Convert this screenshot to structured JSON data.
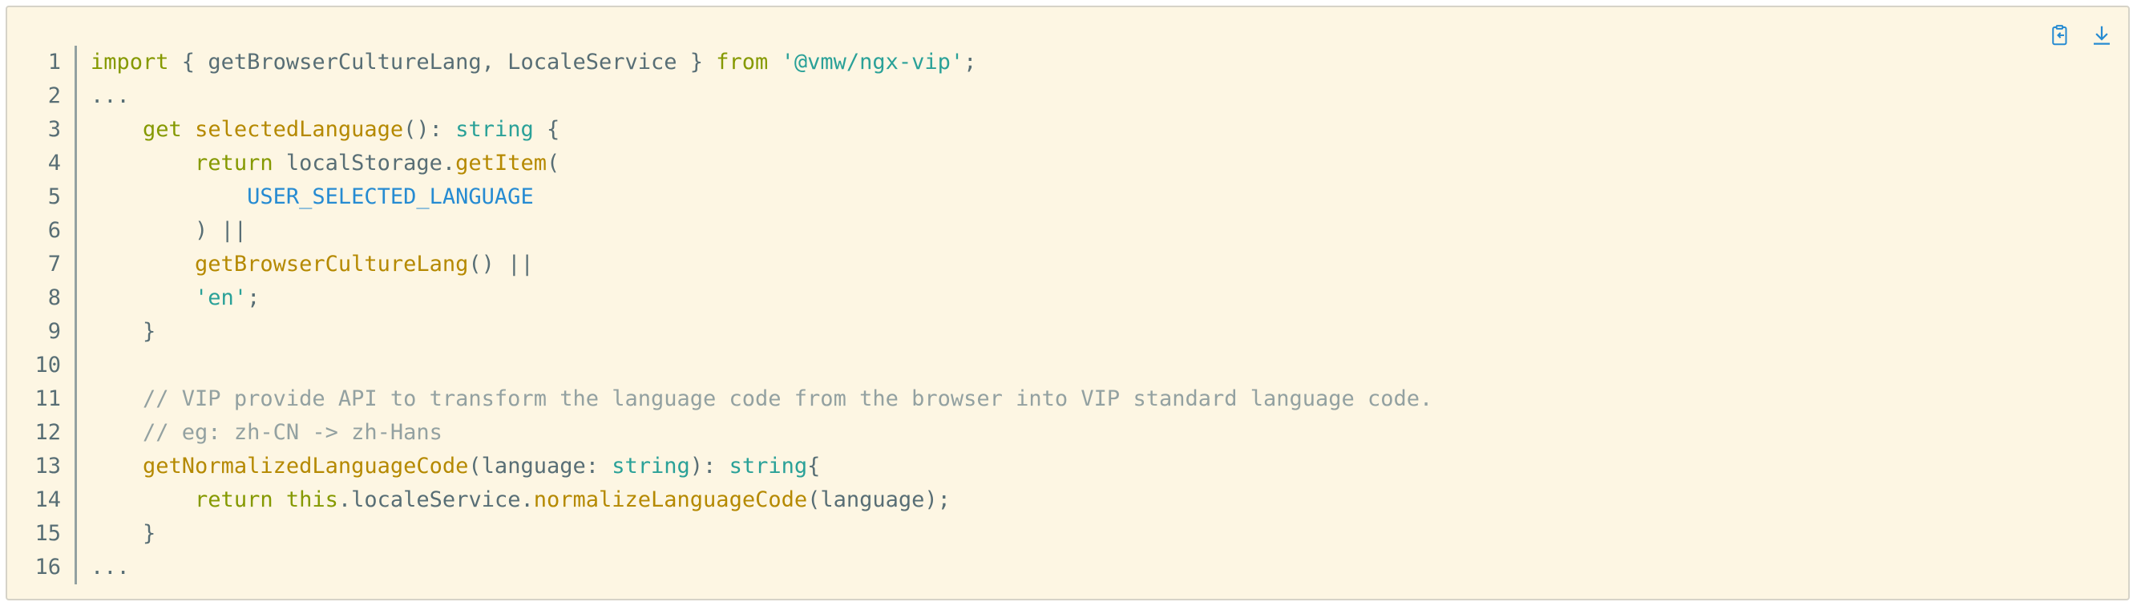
{
  "colors": {
    "background": "#fdf6e3",
    "keyword": "#859900",
    "function": "#b58900",
    "string": "#2aa198",
    "constant": "#268bd2",
    "comment": "#93a1a1",
    "text": "#586e75",
    "icon": "#268bd2"
  },
  "toolbar": {
    "copy_icon": "clipboard-copy-icon",
    "download_icon": "download-icon"
  },
  "line_numbers": [
    "1",
    "2",
    "3",
    "4",
    "5",
    "6",
    "7",
    "8",
    "9",
    "10",
    "11",
    "12",
    "13",
    "14",
    "15",
    "16"
  ],
  "lines": [
    [
      {
        "t": "import",
        "c": "kw"
      },
      {
        "t": " { getBrowserCultureLang, LocaleService } ",
        "c": "plain"
      },
      {
        "t": "from",
        "c": "kw"
      },
      {
        "t": " ",
        "c": "plain"
      },
      {
        "t": "'@vmw/ngx-vip'",
        "c": "str"
      },
      {
        "t": ";",
        "c": "plain"
      }
    ],
    [
      {
        "t": "...",
        "c": "plain"
      }
    ],
    [
      {
        "t": "    ",
        "c": "plain"
      },
      {
        "t": "get",
        "c": "kw"
      },
      {
        "t": " ",
        "c": "plain"
      },
      {
        "t": "selectedLanguage",
        "c": "fn"
      },
      {
        "t": "(): ",
        "c": "plain"
      },
      {
        "t": "string",
        "c": "type"
      },
      {
        "t": " {",
        "c": "plain"
      }
    ],
    [
      {
        "t": "        ",
        "c": "plain"
      },
      {
        "t": "return",
        "c": "kw"
      },
      {
        "t": " localStorage.",
        "c": "plain"
      },
      {
        "t": "getItem",
        "c": "fn"
      },
      {
        "t": "(",
        "c": "plain"
      }
    ],
    [
      {
        "t": "            ",
        "c": "plain"
      },
      {
        "t": "USER_SELECTED_LANGUAGE",
        "c": "const"
      }
    ],
    [
      {
        "t": "        ) ||",
        "c": "plain"
      }
    ],
    [
      {
        "t": "        ",
        "c": "plain"
      },
      {
        "t": "getBrowserCultureLang",
        "c": "fn"
      },
      {
        "t": "() ||",
        "c": "plain"
      }
    ],
    [
      {
        "t": "        ",
        "c": "plain"
      },
      {
        "t": "'en'",
        "c": "str"
      },
      {
        "t": ";",
        "c": "plain"
      }
    ],
    [
      {
        "t": "    }",
        "c": "plain"
      }
    ],
    [
      {
        "t": "",
        "c": "plain"
      }
    ],
    [
      {
        "t": "    ",
        "c": "plain"
      },
      {
        "t": "// VIP provide API to transform the language code from the browser into VIP standard language code.",
        "c": "cm"
      }
    ],
    [
      {
        "t": "    ",
        "c": "plain"
      },
      {
        "t": "// eg: zh-CN -> zh-Hans",
        "c": "cm"
      }
    ],
    [
      {
        "t": "    ",
        "c": "plain"
      },
      {
        "t": "getNormalizedLanguageCode",
        "c": "fn"
      },
      {
        "t": "(language: ",
        "c": "plain"
      },
      {
        "t": "string",
        "c": "type"
      },
      {
        "t": "): ",
        "c": "plain"
      },
      {
        "t": "string",
        "c": "type"
      },
      {
        "t": "{",
        "c": "plain"
      }
    ],
    [
      {
        "t": "        ",
        "c": "plain"
      },
      {
        "t": "return",
        "c": "kw"
      },
      {
        "t": " ",
        "c": "plain"
      },
      {
        "t": "this",
        "c": "kw"
      },
      {
        "t": ".localeService.",
        "c": "plain"
      },
      {
        "t": "normalizeLanguageCode",
        "c": "fn"
      },
      {
        "t": "(language);",
        "c": "plain"
      }
    ],
    [
      {
        "t": "    }",
        "c": "plain"
      }
    ],
    [
      {
        "t": "...",
        "c": "plain"
      }
    ]
  ]
}
